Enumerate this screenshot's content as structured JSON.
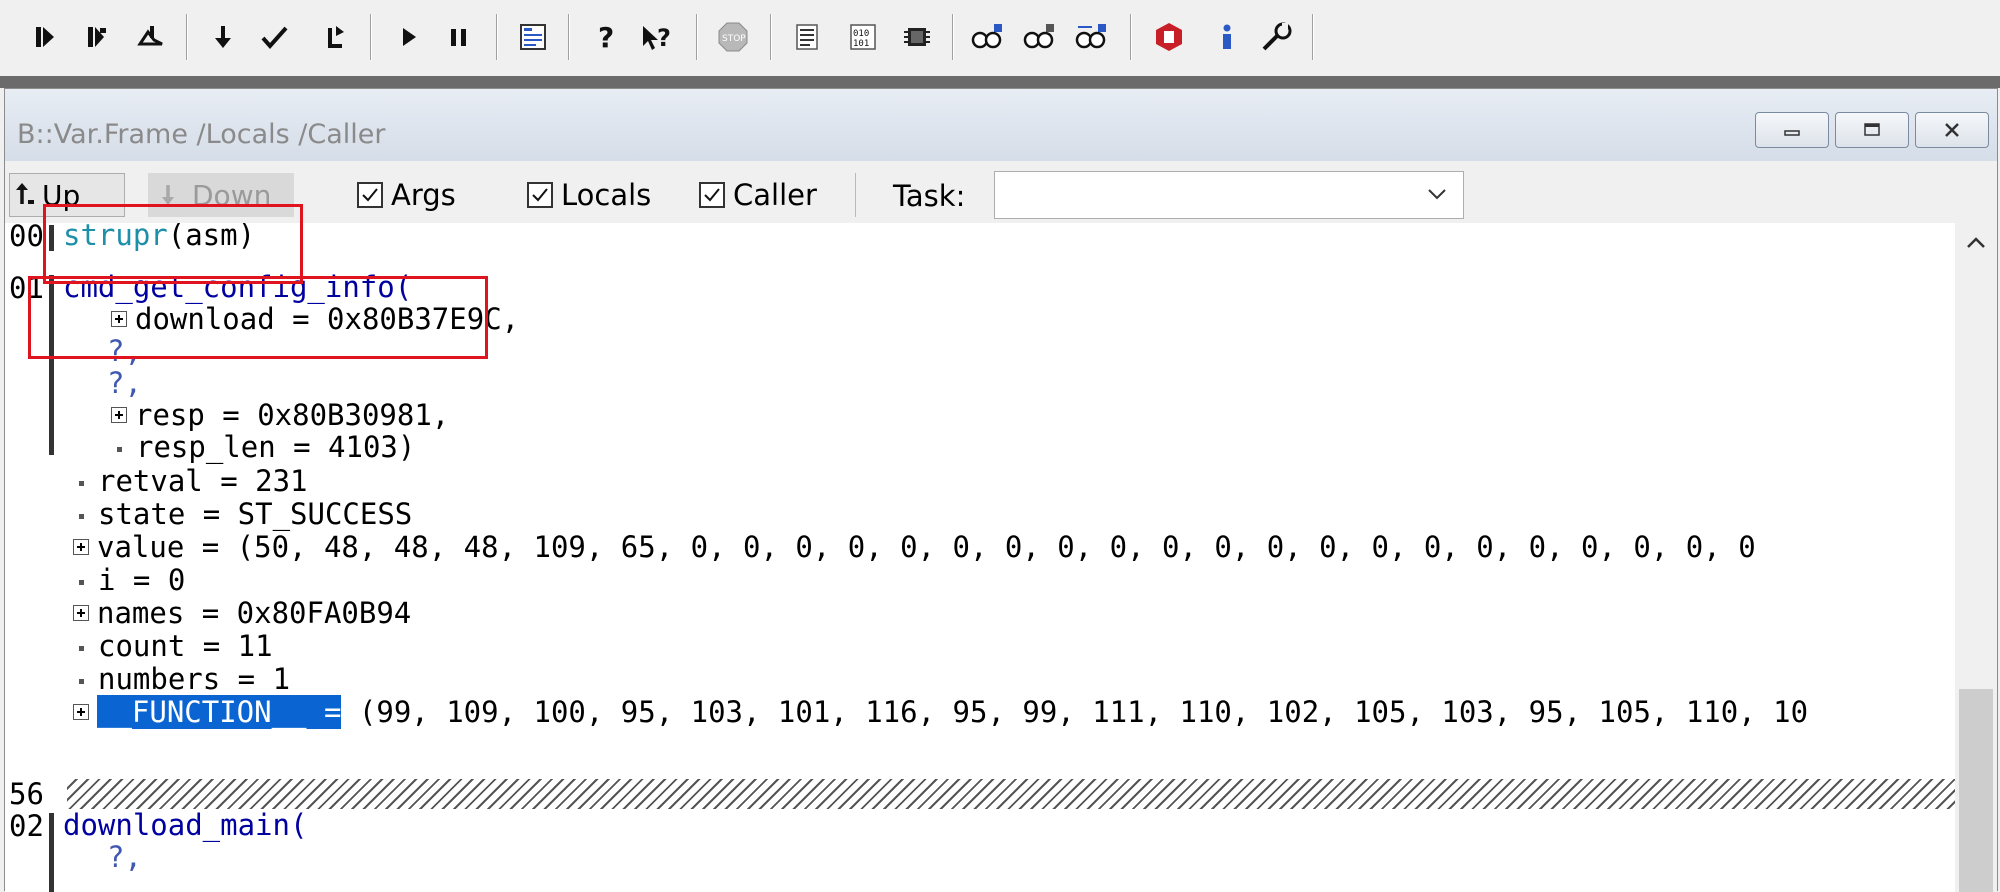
{
  "window": {
    "title": "B::Var.Frame /Locals /Caller"
  },
  "toolbar": {
    "icons": [
      "step-into-icon",
      "step-over-icon",
      "step-return-icon",
      "step-down-icon",
      "step-check-icon",
      "return-icon",
      "go-icon",
      "break-icon",
      "nodebug-icon",
      "help-icon",
      "context-help-icon",
      "stop-icon",
      "list-icon",
      "memory-icon",
      "chip-icon",
      "view-var-icon",
      "watch-var-icon",
      "frame-var-icon",
      "trace32-icon",
      "info-icon",
      "settings-icon"
    ]
  },
  "options": {
    "up_label": "Up",
    "down_label": "Down",
    "args_label": "Args",
    "locals_label": "Locals",
    "caller_label": "Caller",
    "task_label": "Task:",
    "task_value": ""
  },
  "frames": {
    "f00_num": "00",
    "f00_fn": "strupr",
    "f00_rest": "(asm)",
    "f01_num": "01",
    "f01_fn": "cmd_get_config_info(",
    "arg_download": "download = 0x80B37E9C,",
    "arg_q1": "?,",
    "arg_q2": "?,",
    "arg_resp": "resp = 0x80B30981,",
    "arg_resp_len": "resp_len = 4103)",
    "loc_retval": "retval = 231",
    "loc_state": "state = ST_SUCCESS",
    "loc_value": "value = (50, 48, 48, 48, 109, 65, 0, 0, 0, 0, 0, 0, 0, 0, 0, 0, 0, 0, 0, 0, 0, 0, 0, 0, 0, 0, 0",
    "loc_i": "i = 0",
    "loc_names": "names = 0x80FA0B94",
    "loc_count": "count = 11",
    "loc_numbers": "numbers = 1",
    "loc_function_name": "__FUNCTION__ =",
    "loc_function_val": " (99, 109, 100, 95, 103, 101, 116, 95, 99, 111, 110, 102, 105, 103, 95, 105, 110, 10",
    "line56_num": "56",
    "f02_num": "02",
    "f02_fn": "download_main(",
    "f02_q1": "?,"
  },
  "colors": {
    "annotation": "#e0141e",
    "function_name": "#0000a0",
    "asm_name": "#1d8fa8",
    "selection": "#0a64d2"
  }
}
